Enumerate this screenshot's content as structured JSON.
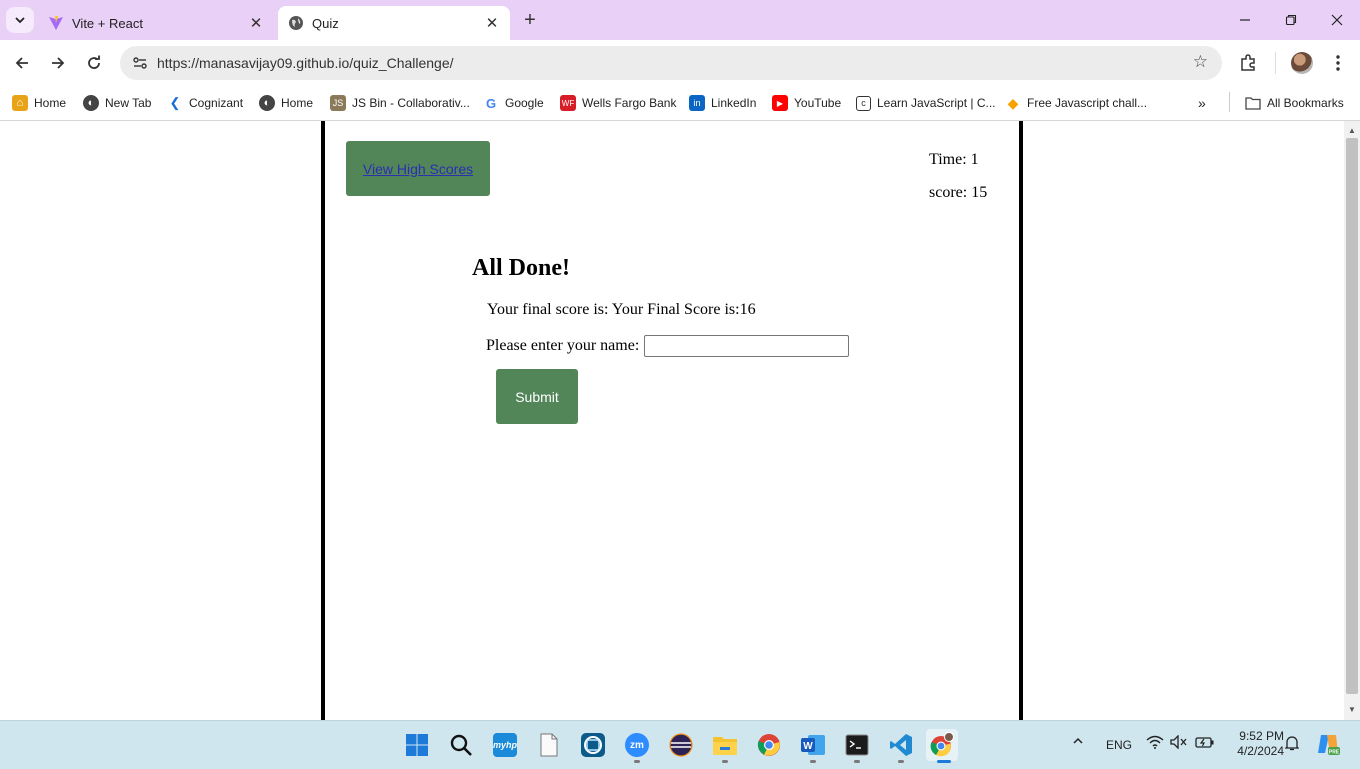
{
  "browser": {
    "tabs": [
      {
        "title": "Vite + React",
        "icon": "vite-icon"
      },
      {
        "title": "Quiz",
        "icon": "globe-icon"
      }
    ],
    "url": "https://manasavijay09.github.io/quiz_Challenge/",
    "bookmarks": [
      {
        "label": "Home",
        "icon": "home-icon"
      },
      {
        "label": "New Tab",
        "icon": "globe-icon"
      },
      {
        "label": "Cognizant",
        "icon": "cognizant-icon"
      },
      {
        "label": "Home",
        "icon": "globe-icon"
      },
      {
        "label": "JS Bin - Collaborativ...",
        "icon": "jsbin-icon"
      },
      {
        "label": "Google",
        "icon": "google-icon"
      },
      {
        "label": "Wells Fargo Bank",
        "icon": "wellsfargo-icon"
      },
      {
        "label": "LinkedIn",
        "icon": "linkedin-icon"
      },
      {
        "label": "YouTube",
        "icon": "youtube-icon"
      },
      {
        "label": "Learn JavaScript | C...",
        "icon": "codecademy-icon"
      },
      {
        "label": "Free Javascript chall...",
        "icon": "diamond-icon"
      }
    ],
    "all_bookmarks_label": "All Bookmarks"
  },
  "quiz": {
    "high_scores_link": "View High Scores",
    "timer": "Time: 1",
    "score": "score: 15",
    "title": "All Done!",
    "final_score": "Your final score is: Your Final Score is:16",
    "name_prompt": "Please enter your name:",
    "name_value": "",
    "submit_label": "Submit"
  },
  "taskbar": {
    "language": "ENG",
    "time": "9:52 PM",
    "date": "4/2/2024",
    "apps": [
      "start-icon",
      "search-icon",
      "myhp-icon",
      "notepad-icon",
      "browser-frame-icon",
      "zoom-icon",
      "eclipse-icon",
      "file-explorer-icon",
      "chrome-icon",
      "word-icon",
      "terminal-icon",
      "vscode-icon",
      "chrome-profile-icon"
    ]
  }
}
